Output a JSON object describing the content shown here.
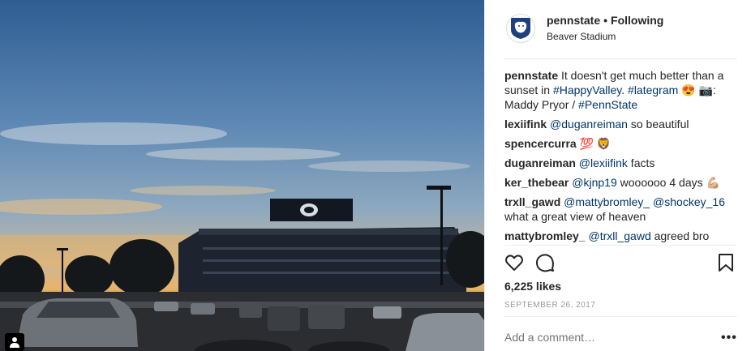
{
  "post": {
    "username": "pennstate",
    "separator": "•",
    "follow_state": "Following",
    "location": "Beaver Stadium",
    "likes": "6,225 likes",
    "date": "September 26, 2017"
  },
  "caption": {
    "user": "pennstate",
    "text_1": " It doesn't get much better than a sunset in ",
    "hashtag_1": "#HappyValley",
    "text_2": ". ",
    "hashtag_2": "#lategram",
    "text_3": " 😍 📷: Maddy Pryor / ",
    "hashtag_3": "#PennState"
  },
  "comments": [
    {
      "user": "lexiifink",
      "mention": "@duganreiman",
      "text": " so beautiful"
    },
    {
      "user": "spencercurra",
      "mention": "",
      "text": " 💯 🦁"
    },
    {
      "user": "duganreiman",
      "mention": "@lexiifink",
      "text": " facts"
    },
    {
      "user": "ker_thebear",
      "mention": "@kjnp19",
      "text": " woooooo 4 days 💪🏼"
    },
    {
      "user": "trxll_gawd",
      "mention": "@mattybromley_ @shockey_16",
      "text": " what a great view of heaven"
    },
    {
      "user": "mattybromley_",
      "mention": "@trxll_gawd",
      "text": " agreed bro"
    }
  ],
  "add_comment_placeholder": "Add a comment…",
  "more_label": "•••",
  "icons": {
    "like": "heart-icon",
    "comment": "comment-icon",
    "save": "bookmark-icon",
    "tagged": "person-tag-icon",
    "avatar": "nittany-lion-logo"
  },
  "colors": {
    "link": "#003569",
    "muted": "#999999",
    "text": "#262626",
    "brand_navy": "#1e407c"
  }
}
